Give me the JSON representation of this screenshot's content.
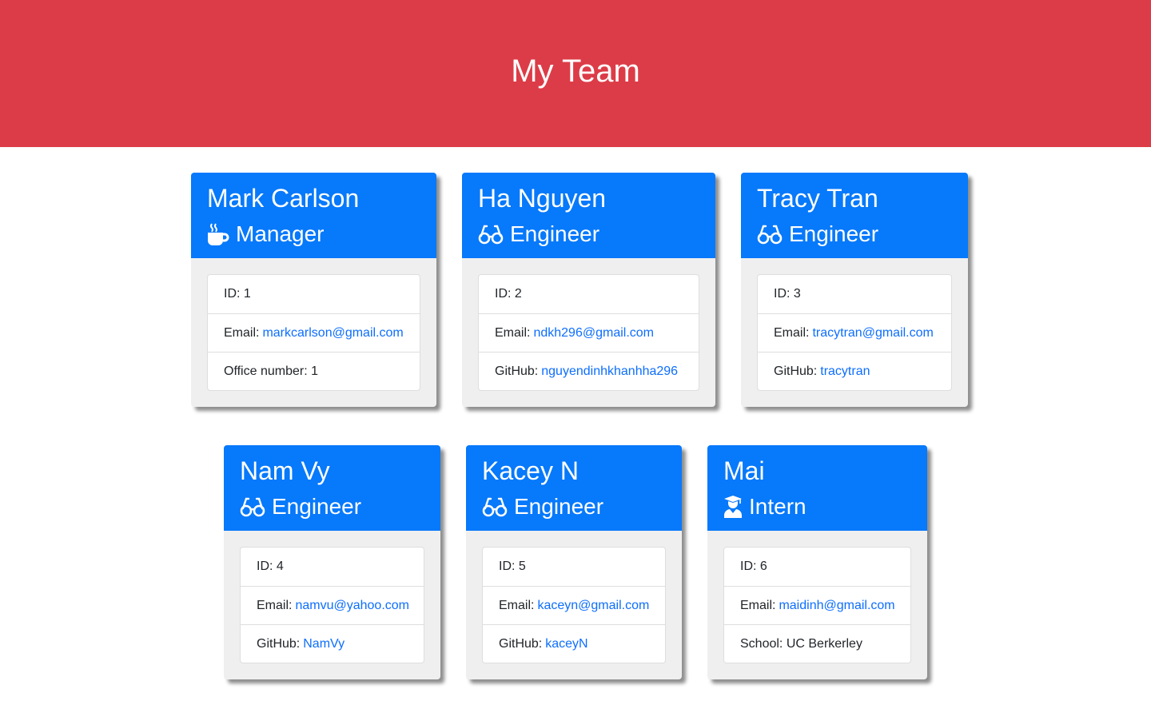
{
  "header": {
    "title": "My Team"
  },
  "team": [
    {
      "name": "Mark Carlson",
      "role": "Manager",
      "icon": "mug-icon",
      "id_label": "ID: 1",
      "email_label": "Email:",
      "email": "markcarlson@gmail.com",
      "extra_label": "Office number: 1",
      "extra_link": ""
    },
    {
      "name": "Ha Nguyen",
      "role": "Engineer",
      "icon": "glasses-icon",
      "id_label": "ID: 2",
      "email_label": "Email:",
      "email": "ndkh296@gmail.com",
      "extra_label": "GitHub:",
      "extra_link": "nguyendinhkhanhha296"
    },
    {
      "name": "Tracy Tran",
      "role": "Engineer",
      "icon": "glasses-icon",
      "id_label": "ID: 3",
      "email_label": "Email:",
      "email": "tracytran@gmail.com",
      "extra_label": "GitHub:",
      "extra_link": "tracytran"
    },
    {
      "name": "Nam Vy",
      "role": "Engineer",
      "icon": "glasses-icon",
      "id_label": "ID: 4",
      "email_label": "Email:",
      "email": "namvu@yahoo.com",
      "extra_label": "GitHub:",
      "extra_link": "NamVy"
    },
    {
      "name": "Kacey N",
      "role": "Engineer",
      "icon": "glasses-icon",
      "id_label": "ID: 5",
      "email_label": "Email:",
      "email": "kaceyn@gmail.com",
      "extra_label": "GitHub:",
      "extra_link": "kaceyN"
    },
    {
      "name": "Mai",
      "role": "Intern",
      "icon": "graduate-icon",
      "id_label": "ID: 6",
      "email_label": "Email:",
      "email": "maidinh@gmail.com",
      "extra_label": "School: UC Berkerley",
      "extra_link": ""
    }
  ],
  "colors": {
    "header_bg": "#dc3c47",
    "card_header_bg": "#0779fb",
    "link": "#0d6efd"
  }
}
